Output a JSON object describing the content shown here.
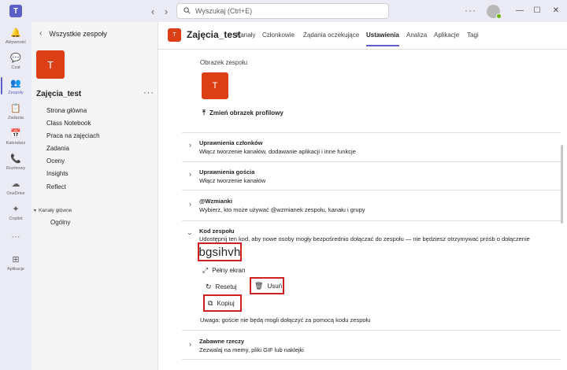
{
  "titlebar": {
    "app_logo": "T",
    "back_icon": "‹",
    "forward_icon": "›",
    "search_placeholder": "Wyszukaj (Ctrl+E)",
    "more": "···",
    "minimize": "—",
    "maximize": "☐",
    "close": "✕"
  },
  "rail": {
    "items": [
      {
        "label": "Aktywność",
        "icon": "bell-icon",
        "glyph": "🔔"
      },
      {
        "label": "Czat",
        "icon": "chat-icon",
        "glyph": "💬"
      },
      {
        "label": "Zespoły",
        "icon": "teams-icon",
        "glyph": "👥"
      },
      {
        "label": "Zadania",
        "icon": "assignments-icon",
        "glyph": "📋"
      },
      {
        "label": "Kalendarz",
        "icon": "calendar-icon",
        "glyph": "📅"
      },
      {
        "label": "Rozmowy",
        "icon": "phone-icon",
        "glyph": "📞"
      },
      {
        "label": "OneDrive",
        "icon": "cloud-icon",
        "glyph": "☁"
      },
      {
        "label": "Copilot",
        "icon": "copilot-icon",
        "glyph": "✦"
      },
      {
        "label": "",
        "icon": "more-apps-icon",
        "glyph": "···"
      },
      {
        "label": "Aplikacje",
        "icon": "add-app-icon",
        "glyph": "⊞"
      }
    ],
    "active_index": 2
  },
  "sidebar": {
    "back_label": "Wszystkie zespoły",
    "team_initial": "T",
    "team_name": "Zajęcia_test",
    "more": "···",
    "links": [
      "Strona główna",
      "Class Notebook",
      "Praca na zajęciach",
      "Zadania",
      "Oceny",
      "Insights",
      "Reflect"
    ],
    "channels_header": "Kanały główne",
    "channel": "Ogólny"
  },
  "header": {
    "team_initial": "T",
    "title": "Zajęcia_test",
    "tabs": [
      "Kanały",
      "Członkowie",
      "Żądania oczekujące",
      "Ustawienia",
      "Analiza",
      "Aplikacje",
      "Tagi"
    ],
    "active_tab": "Ustawienia"
  },
  "settings": {
    "picture_label": "Obrazek zespołu",
    "picture_initial": "T",
    "change_picture": "Zmień obrazek profilowy",
    "sections": [
      {
        "title": "Uprawnienia członków",
        "desc": "Włącz tworzenie kanałów, dodawanie aplikacji i inne funkcje"
      },
      {
        "title": "Uprawnienia gościa",
        "desc": "Włącz tworzenie kanałów"
      },
      {
        "title": "@Wzmianki",
        "desc": "Wybierz, kto może używać @wzmianek zespołu, kanału i grupy"
      },
      {
        "title": "Kod zespołu",
        "desc": "Udostępnij ten kod, aby nowe osoby mogły bezpośrednio dołączać do zespołu — nie będziesz otrzymywać próśb o dołączenie"
      },
      {
        "title": "Zabawne rzeczy",
        "desc": "Zezwalaj na memy, pliki GIF lub naklejki"
      }
    ],
    "team_code": "bgsihvh",
    "fullscreen": "Pełny ekran",
    "reset": "Resetuj",
    "remove": "Usuń",
    "copy": "Kopiuj",
    "note": "Uwaga: goście nie będą mogli dołączyć za pomocą kodu zespołu"
  }
}
